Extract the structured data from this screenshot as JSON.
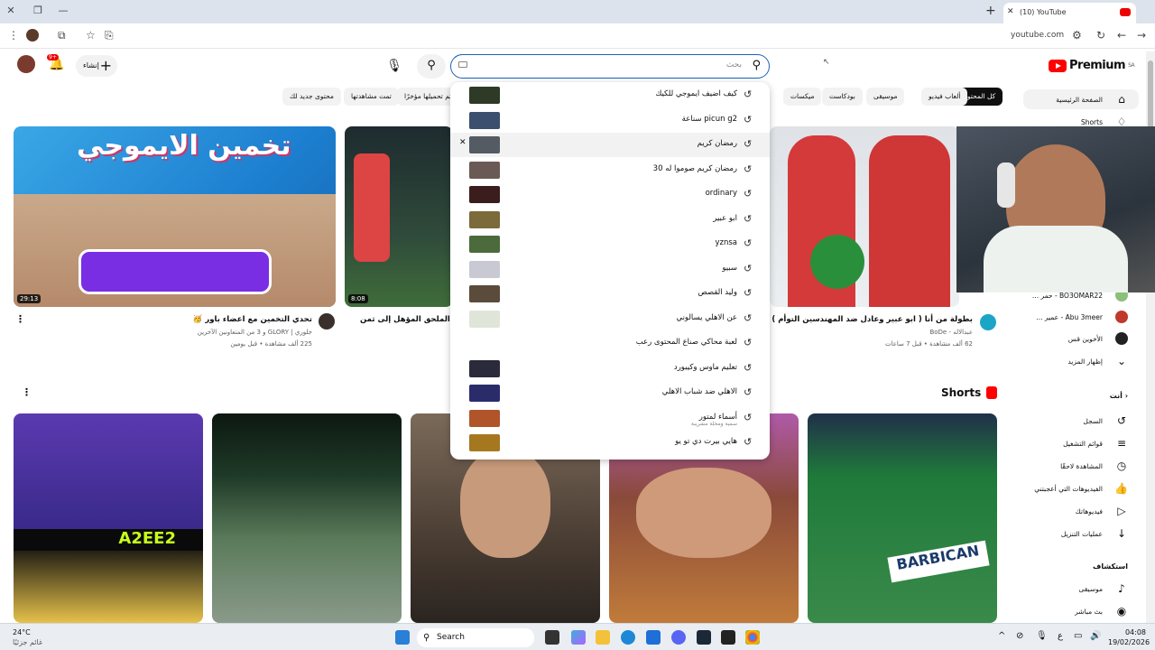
{
  "browser": {
    "tab_title": "(10) YouTube",
    "url": "youtube.com"
  },
  "youtube": {
    "logo_text": "Premium",
    "logo_region": "SA",
    "search_placeholder": "بحث",
    "create_label": "إنشاء",
    "notifications_badge": "9+",
    "chips": [
      "كل المحتوى",
      "ألعاب فيديو",
      "موسيقى",
      "بودكاست",
      "ميكسات",
      "تم تحميلها مؤخرًا",
      "تمت مشاهدتها",
      "محتوى جديد لك"
    ]
  },
  "suggestions": [
    {
      "text": "كيف اضيف ايموجي للكيك",
      "thumb": "#2e3a26"
    },
    {
      "text": "picun g2 سناعة",
      "thumb": "#3d4f6e"
    },
    {
      "text": "رمضان كريم",
      "thumb": "#555b63",
      "highlighted": true
    },
    {
      "text": "رمضان كريم صوموا له 30",
      "thumb": "#6a5a55"
    },
    {
      "text": "ordinary",
      "thumb": "#3b1d1d"
    },
    {
      "text": "ابو عبير",
      "thumb": "#7b6a3a"
    },
    {
      "text": "yznsa",
      "thumb": "#4c6b3c"
    },
    {
      "text": "سبيو",
      "thumb": "#c9c9d4"
    },
    {
      "text": "وليد القصص",
      "thumb": "#5b4b3a"
    },
    {
      "text": "عن الاهلي يسالوني",
      "thumb": "#dfe6d9"
    },
    {
      "text": "لعبة محاكي صناع المحتوى رعب",
      "thumb": ""
    },
    {
      "text": "تعليم ماوس وكيبورد",
      "thumb": "#2b2a3a"
    },
    {
      "text": "الاهلي ضد شباب الاهلي",
      "thumb": "#2a2c6a"
    },
    {
      "text": "أسماء لمتور",
      "sub": "سمية ومحلة مشريبة",
      "thumb": "#b0552a"
    },
    {
      "text": "هايي بيرت دي تو يو",
      "thumb": "#a57820"
    }
  ],
  "sidebar": {
    "home": "الصفحة الرئيسية",
    "shorts": "Shorts",
    "subs": [
      {
        "name": "BO3OMAR22 - حمر ...",
        "color": "#8bbf7a"
      },
      {
        "name": "Abu 3meer - عمير ...",
        "color": "#c0392b"
      },
      {
        "name": "الأخوين قس",
        "color": "#222"
      }
    ],
    "show_more": "إظهار المزيد",
    "you_header": "أنت",
    "you_items": [
      "السجل",
      "قوائم التشغيل",
      "المشاهدة لاحقًا",
      "الفيديوهات التي أعجبتني",
      "فيديوهاتك",
      "عمليات التنزيل"
    ],
    "explore_header": "استكشاف",
    "explore_items": [
      "موسيقى",
      "بث مباشر"
    ]
  },
  "videos": [
    {
      "title": "تحدي التخمين مع اعضاء باور 🥳",
      "channel": "جلوري | GLORY و 3 من المتعاونين الآخرين",
      "meta": "225 ألف مشاهدة • قبل يومين",
      "duration": "29:13",
      "overlay": "تخمين الايموجي"
    },
    {
      "title": "ذهاب الملحق المؤهل إلى ثمن ...",
      "duration": "8:08"
    },
    {
      "title": "بطولة من أنا ( ابو عبير وعادل ضد المهندسين التوأم )",
      "channel": "عبدالاله - BoDe",
      "meta": "62 ألف مشاهدة • قبل 7 ساعات"
    }
  ],
  "shorts_title": "Shorts",
  "shorts_overlay": "A2EE2",
  "taskbar": {
    "search": "Search",
    "temp": "24°C",
    "weather_desc": "غائم جزئيًا",
    "time": "04:08",
    "date": "19/02/2026"
  }
}
